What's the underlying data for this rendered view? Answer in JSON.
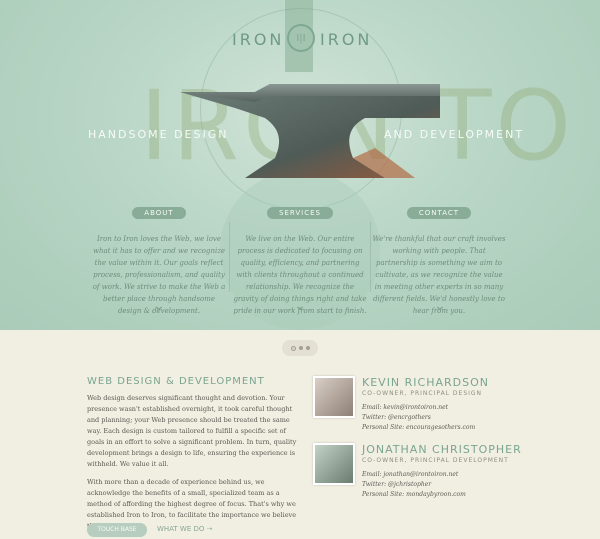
{
  "logo": {
    "left": "IRON",
    "right": "IRON",
    "mark": "I|I"
  },
  "hero": {
    "watermark": "IRON TO IRON",
    "tag_left": "HANDSOME DESIGN",
    "tag_right": "AND DEVELOPMENT"
  },
  "sections": [
    {
      "label": "ABOUT",
      "text": "Iron to Iron loves the Web, we love what it has to offer and we recognize the value within it. Our goals reflect process, professionalism, and quality of work. We strive to make the Web a better place through handsome design & development."
    },
    {
      "label": "SERVICES",
      "text": "We live on the Web. Our entire process is dedicated to focusing on quality, efficiency, and partnering with clients throughout a continued relationship. We recognize the gravity of doing things right and take pride in our work from start to finish."
    },
    {
      "label": "CONTACT",
      "text": "We're thankful that our craft involves working with people. That partnership is something we aim to cultivate, as we recognize the value in meeting other experts in so many different fields. We'd honestly love to hear from you."
    }
  ],
  "main": {
    "heading": "WEB DESIGN & DEVELOPMENT",
    "paragraphs": [
      "Web design deserves significant thought and devotion. Your presence wasn't established overnight, it took careful thought and planning; your Web presence should be treated the same way. Each design is custom tailored to fulfill a specific set of goals in an effort to solve a significant problem. In turn, quality development brings a design to life, ensuring the experience is withheld. We value it all.",
      "With more than a decade of experience behind us, we acknowledge the benefits of a small, specialized team as a method of affording the highest degree of focus. That's why we established Iron to Iron, to facilitate the importance we believe the Web deserves."
    ],
    "button_label": "TOUCH BASE",
    "link_label": "WHAT WE DO ➝"
  },
  "people": [
    {
      "name": "KEVIN RICHARDSON",
      "role": "CO-OWNER, PRINCIPAL DESIGN",
      "email": "Email: kevin@irontoiron.net",
      "twitter": "Twitter: @encrgothers",
      "site": "Personal Site: encouragesothers.com"
    },
    {
      "name": "JONATHAN CHRISTOPHER",
      "role": "CO-OWNER, PRINCIPAL DEVELOPMENT",
      "email": "Email: jonathan@irontoiron.net",
      "twitter": "Twitter: @jchristopher",
      "site": "Personal Site: mondaybyroon.com"
    }
  ],
  "colors": {
    "accent": "#7aa591",
    "hero": "#b9d6c6",
    "page": "#f1eee2"
  }
}
